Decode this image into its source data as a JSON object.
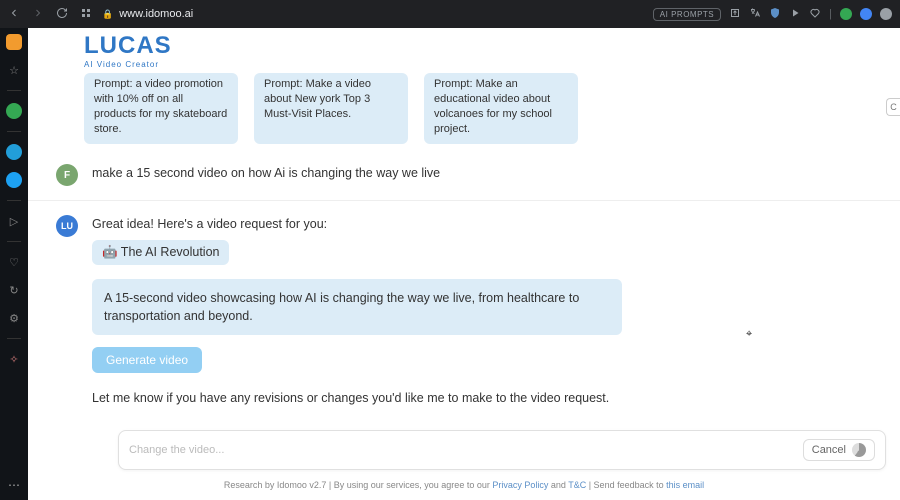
{
  "chrome": {
    "url": "www.idomoo.ai",
    "ai_prompts_label": "AI PROMPTS"
  },
  "logo": {
    "title": "LUCAS",
    "subtitle": "AI Video Creator"
  },
  "cards": [
    {
      "text": "Prompt: a video promotion with 10% off on all products for my skateboard store."
    },
    {
      "text": "Prompt: Make a video about New york Top 3 Must-Visit Places."
    },
    {
      "text": "Prompt: Make an educational video about volcanoes for my school project."
    }
  ],
  "corner_label": "C",
  "chat": {
    "user_initial": "F",
    "user_msg": "make a 15 second video on how Ai is changing the way we live",
    "bot_initial": "LU",
    "bot_intro": "Great idea! Here's a video request for you:",
    "title_chip": "🤖 The AI Revolution",
    "description": "A 15-second video showcasing how AI is changing the way we live, from healthcare to transportation and beyond.",
    "generate_label": "Generate video",
    "revise_note": "Let me know if you have any revisions or changes you'd like me to make to the video request."
  },
  "composer": {
    "placeholder": "Change the video...",
    "cancel_label": "Cancel"
  },
  "footer": {
    "pre": "Research by Idomoo v2.7 | By using our services, you agree to our ",
    "privacy": "Privacy Policy",
    "and": " and ",
    "tc": "T&C",
    "mid": " | Send feedback to ",
    "email": "this email"
  }
}
